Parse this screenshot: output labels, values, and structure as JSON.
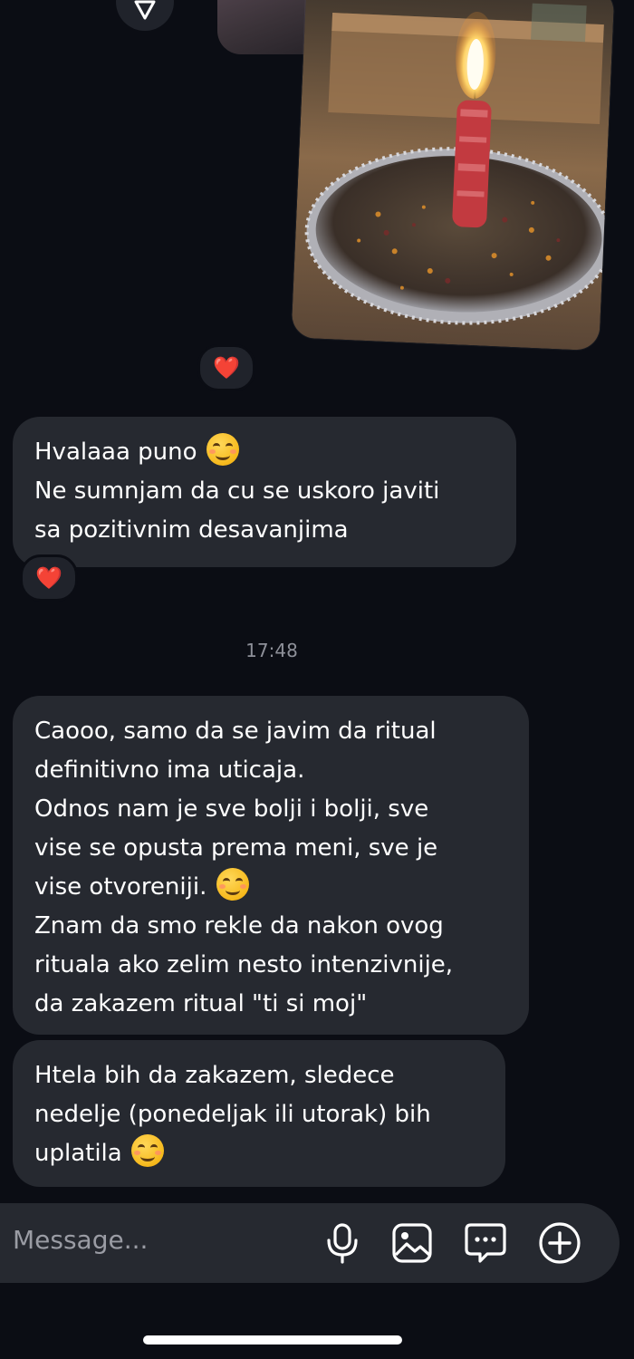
{
  "messages": [
    {
      "id": "m1",
      "lines": [
        "Hvalaaa puno",
        "Ne sumnjam da cu se uskoro javiti",
        "sa pozitivnim desavanjima"
      ],
      "emoji_after_line": 0,
      "reaction": "❤️"
    },
    {
      "id": "m2",
      "lines": [
        "Caooo, samo da se javim da ritual",
        "definitivno ima uticaja.",
        "Odnos nam je sve bolji i bolji, sve",
        "vise se opusta prema meni, sve je",
        "vise otvoreniji.",
        "Znam da smo rekle da nakon ovog",
        "rituala ako zelim nesto intenzivnije,",
        "da zakazem ritual \"ti si moj\""
      ],
      "emoji_after_line": 4
    },
    {
      "id": "m3",
      "lines": [
        "Htela bih da zakazem, sledece",
        "nedelje (ponedeljak ili utorak) bih",
        "uplatila"
      ],
      "emoji_after_line": 2
    }
  ],
  "photo_reaction": "❤️",
  "timestamp": "17:48",
  "composer": {
    "placeholder": "Message...",
    "icons": [
      "microphone-icon",
      "image-icon",
      "sticker-chat-icon",
      "add-circle-icon"
    ]
  },
  "colors": {
    "background": "#0b0d14",
    "bubble": "#262930",
    "text": "#ffffff",
    "muted": "#8e9099",
    "heart": "#ff2b3d"
  }
}
